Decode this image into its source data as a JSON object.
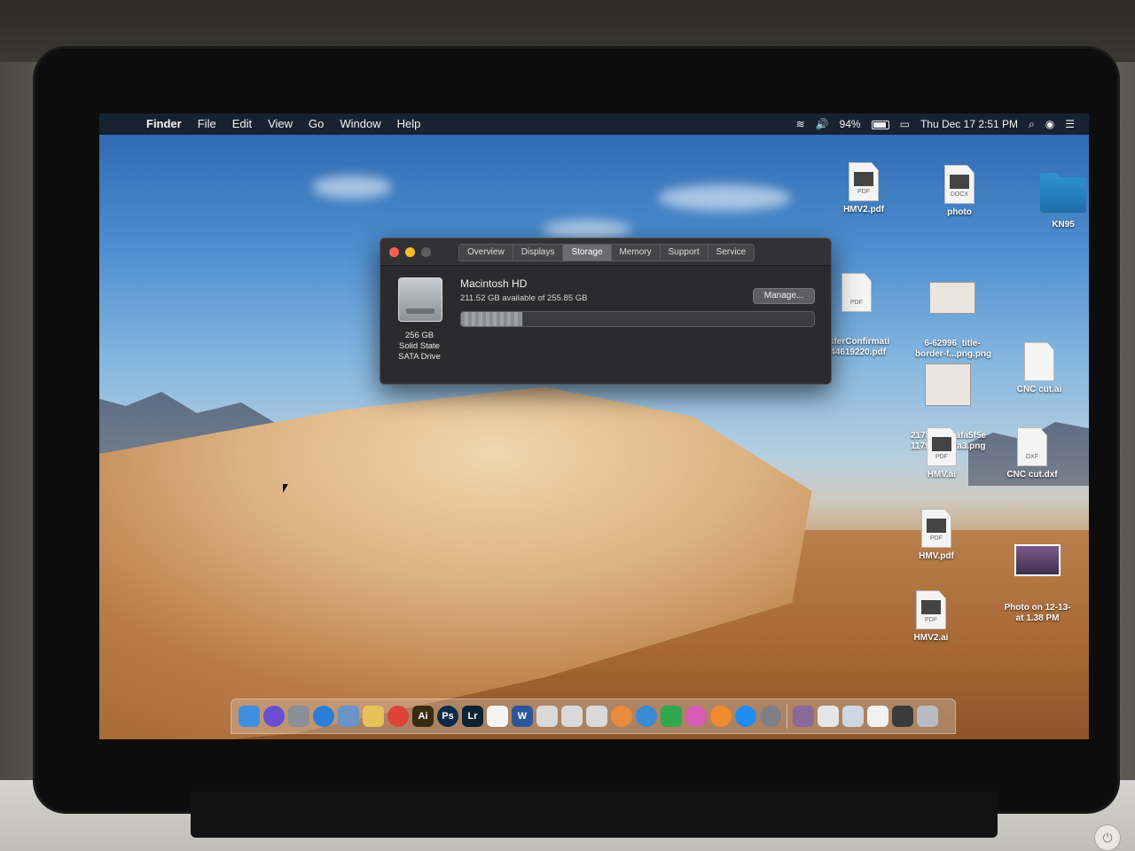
{
  "menubar": {
    "apple": "",
    "items": [
      "Finder",
      "File",
      "Edit",
      "View",
      "Go",
      "Window",
      "Help"
    ],
    "battery": "94%",
    "datetime": "Thu Dec 17  2:51 PM"
  },
  "about_window": {
    "tabs": [
      "Overview",
      "Displays",
      "Storage",
      "Memory",
      "Support",
      "Service"
    ],
    "active_tab": "Storage",
    "drive": {
      "name": "Macintosh HD",
      "available": "211.52 GB available of 255.85 GB",
      "desc_line1": "256 GB",
      "desc_line2": "Solid State",
      "desc_line3": "SATA Drive",
      "used_fraction": 0.173
    },
    "manage_label": "Manage..."
  },
  "desktop": {
    "items": [
      {
        "label": "HMV2.pdf",
        "tag": "PDF"
      },
      {
        "label": "photo",
        "tag": "DOCX"
      },
      {
        "label": "KN95"
      },
      {
        "label": "nsferConfirmati\n-44619220.pdf",
        "tag": "PDF"
      },
      {
        "label": "6-62996_title-\nborder-f...png.png"
      },
      {
        "label": "217b30a7aafa5f5e\n1179e46...0a3.png"
      },
      {
        "label": "CNC cut.ai"
      },
      {
        "label": "HMV.ai",
        "tag": "PDF"
      },
      {
        "label": "CNC cut.dxf",
        "tag": "DXF"
      },
      {
        "label": "HMV.pdf",
        "tag": "PDF"
      },
      {
        "label": "Photo on 12-13-\nat 1.38 PM"
      },
      {
        "label": "HMV2.ai",
        "tag": "PDF"
      }
    ]
  },
  "dock": {
    "apps": [
      {
        "icon": "finder-icon",
        "color": "#3f8fe0"
      },
      {
        "icon": "siri-icon",
        "color": "#6a4ecf"
      },
      {
        "icon": "launchpad-icon",
        "color": "#8a8f99"
      },
      {
        "icon": "safari-icon",
        "color": "#2b7fd8"
      },
      {
        "icon": "preview-icon",
        "color": "#6a93c8"
      },
      {
        "icon": "notes-icon",
        "color": "#e7c15a"
      },
      {
        "icon": "chrome-icon",
        "color": "#db4437"
      },
      {
        "icon": "illustrator-icon",
        "color": "#3a2a12",
        "text": "Ai"
      },
      {
        "icon": "photoshop-icon",
        "color": "#0d2a4a",
        "text": "Ps"
      },
      {
        "icon": "lightroom-icon",
        "color": "#0d2233",
        "text": "Lr"
      },
      {
        "icon": "calendar-icon",
        "color": "#f4f4f4"
      },
      {
        "icon": "word-icon",
        "color": "#2b579a",
        "text": "W"
      },
      {
        "icon": "sheets-icon",
        "color": "#d9d9d9"
      },
      {
        "icon": "numbers-icon",
        "color": "#d9d9d9"
      },
      {
        "icon": "chart-app-icon",
        "color": "#d9d9d9"
      },
      {
        "icon": "photos-icon",
        "color": "#e98b3c"
      },
      {
        "icon": "globe-icon",
        "color": "#3a8ad6"
      },
      {
        "icon": "facetime-icon",
        "color": "#2fa84f"
      },
      {
        "icon": "music-icon",
        "color": "#d65bb6"
      },
      {
        "icon": "books-icon",
        "color": "#ef8b2c"
      },
      {
        "icon": "app-store-icon",
        "color": "#1f8cf0"
      },
      {
        "icon": "system-preferences-icon",
        "color": "#7d7f85"
      }
    ],
    "right": [
      {
        "icon": "photo-booth-icon",
        "color": "#8a6a9a"
      },
      {
        "icon": "document-icon",
        "color": "#e6e6e6"
      },
      {
        "icon": "window-icon",
        "color": "#cfd6df"
      },
      {
        "icon": "file-icon",
        "color": "#f2f2f2"
      },
      {
        "icon": "display-icon",
        "color": "#3b3b3b"
      },
      {
        "icon": "trash-icon",
        "color": "#b8bcc2"
      }
    ]
  }
}
